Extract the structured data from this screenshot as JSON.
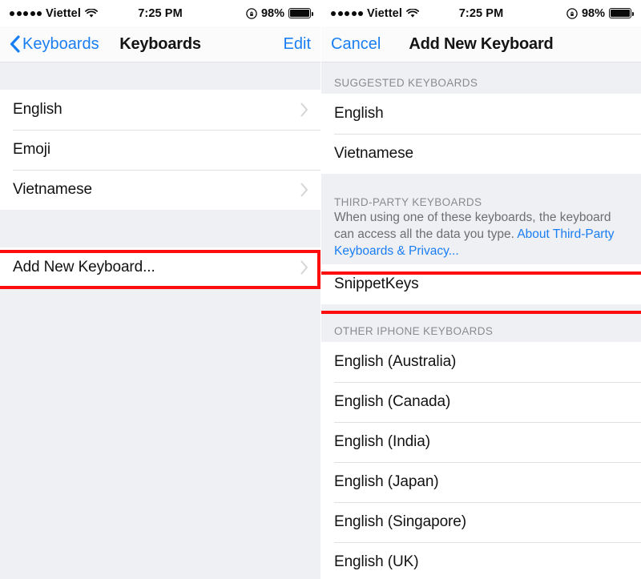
{
  "statusbar": {
    "carrier": "Viettel",
    "signal_dots": 5,
    "wifi_icon": "wifi-icon",
    "time": "7:25 PM",
    "rotation_lock_icon": "rotation-lock-icon",
    "battery_percent": "98%",
    "battery_icon": "battery-full-icon"
  },
  "left_screen": {
    "nav": {
      "back_icon": "chevron-left-icon",
      "back_label": "Keyboards",
      "title": "Keyboards",
      "edit_label": "Edit"
    },
    "keyboards": [
      {
        "label": "English",
        "has_chevron": true
      },
      {
        "label": "Emoji",
        "has_chevron": false
      },
      {
        "label": "Vietnamese",
        "has_chevron": true
      }
    ],
    "add_row": {
      "label": "Add New Keyboard...",
      "has_chevron": true
    }
  },
  "right_screen": {
    "nav": {
      "cancel_label": "Cancel",
      "title": "Add New Keyboard"
    },
    "suggested": {
      "header": "SUGGESTED KEYBOARDS",
      "items": [
        {
          "label": "English"
        },
        {
          "label": "Vietnamese"
        }
      ]
    },
    "third_party": {
      "header": "THIRD-PARTY KEYBOARDS",
      "note_text": "When using one of these keyboards, the keyboard can access all the data you type. ",
      "note_link": "About Third-Party Keyboards & Privacy...",
      "items": [
        {
          "label": "SnippetKeys"
        }
      ]
    },
    "other": {
      "header": "OTHER IPHONE KEYBOARDS",
      "items": [
        {
          "label": "English (Australia)"
        },
        {
          "label": "English (Canada)"
        },
        {
          "label": "English (India)"
        },
        {
          "label": "English (Japan)"
        },
        {
          "label": "English (Singapore)"
        },
        {
          "label": "English (UK)"
        }
      ]
    }
  },
  "annotations": {
    "highlight_color": "#fd0d0d",
    "boxes": [
      {
        "name": "add-new-keyboard-highlight"
      },
      {
        "name": "snippetkeys-highlight"
      }
    ]
  }
}
